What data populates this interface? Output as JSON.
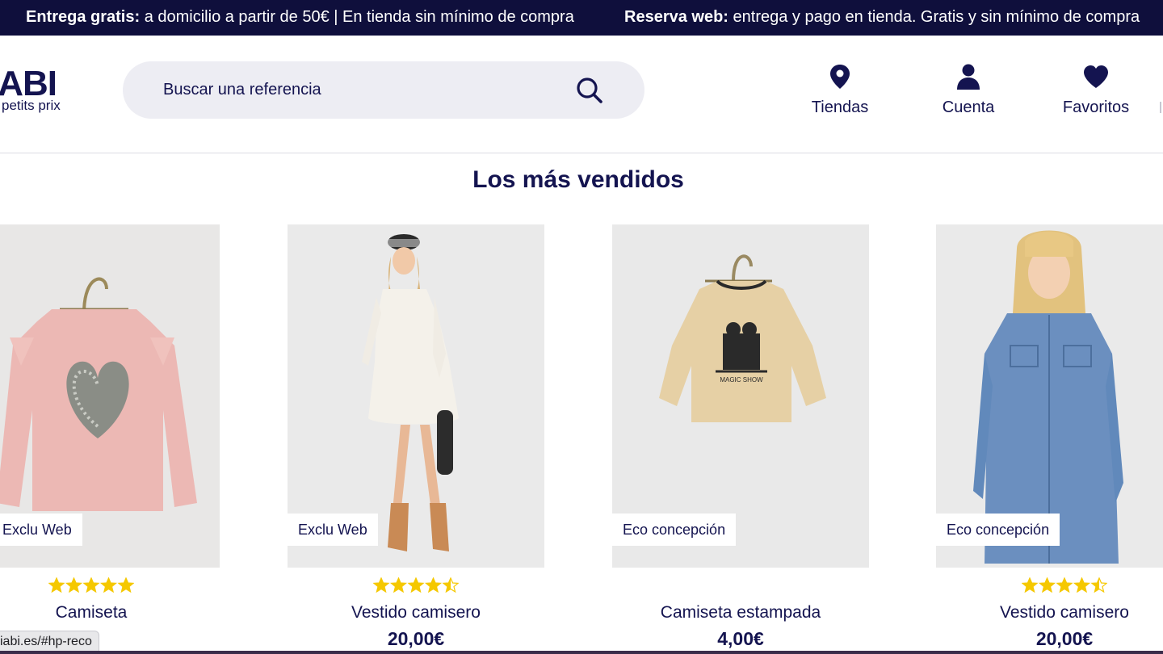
{
  "promo": {
    "item1_strong": "Entrega gratis:",
    "item1_text": " a domicilio a partir de 50€ | En tienda sin mínimo de compra",
    "item2_strong": "Reserva web:",
    "item2_text": " entrega y pago en tienda. Gratis y sin mínimo de compra"
  },
  "header": {
    "logo_word": "IABI",
    "logo_tagline": "petits prix",
    "search_placeholder": "Buscar una referencia",
    "nav": {
      "stores": "Tiendas",
      "account": "Cuenta",
      "favorites": "Favoritos"
    }
  },
  "section": {
    "title": "Los más vendidos"
  },
  "products": [
    {
      "badge": "Exclu Web",
      "name": "Camiseta",
      "price": "",
      "rating": 5,
      "image": "pink-sequin-heart-shirt"
    },
    {
      "badge": "Exclu Web",
      "name": "Vestido camisero",
      "price": "20,00€",
      "rating": 4.5,
      "image": "white-shirt-dress-model"
    },
    {
      "badge": "Eco concepción",
      "name": "Camiseta estampada",
      "price": "4,00€",
      "rating": null,
      "image": "beige-printed-shirt"
    },
    {
      "badge": "Eco concepción",
      "name": "Vestido camisero",
      "price": "20,00€",
      "rating": 4.5,
      "image": "denim-shirt-dress-model"
    }
  ],
  "status_url": "iabi.es/#hp-reco",
  "colors": {
    "navy": "#141450",
    "promo_bg": "#0f0f3c",
    "star": "#f5c800",
    "search_bg": "#ededf3"
  }
}
